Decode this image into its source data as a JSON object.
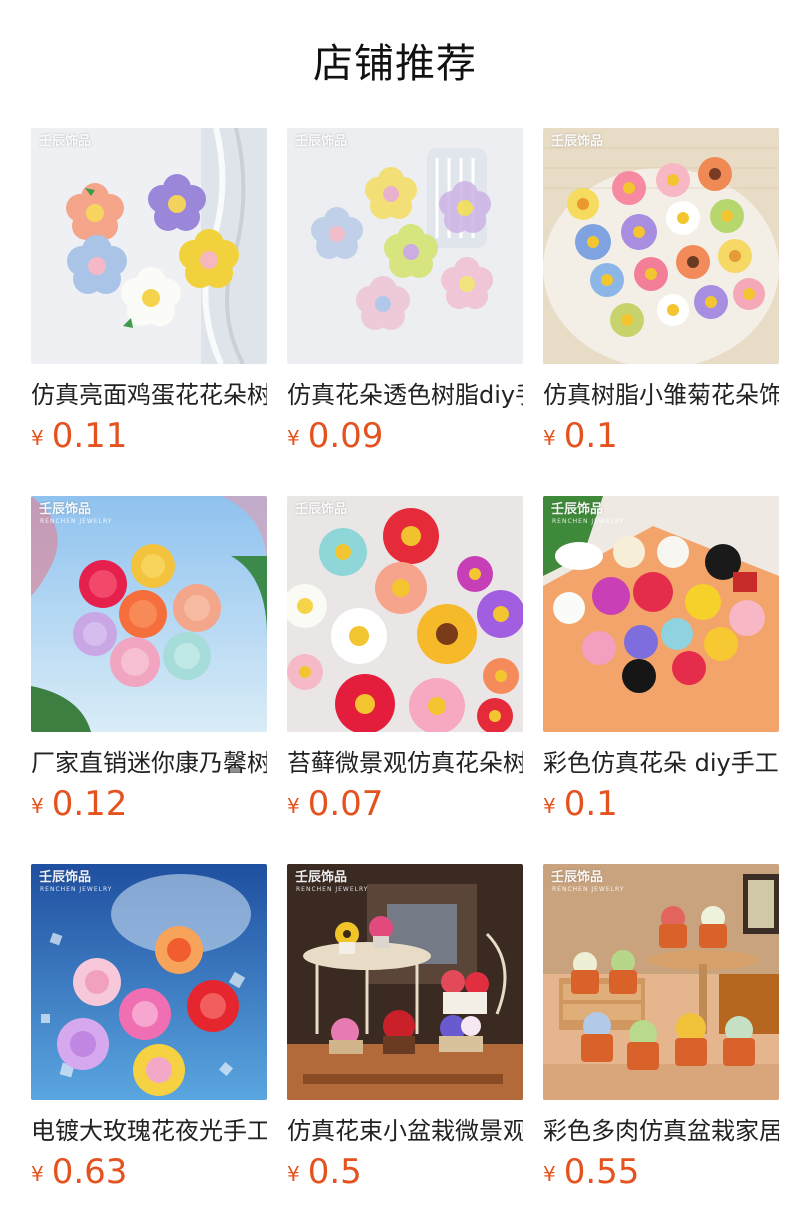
{
  "page_title": "店铺推荐",
  "accent_price_color": "#e4531f",
  "products": [
    {
      "name": "仿真亮面鸡蛋花花朵树脂diy",
      "currency": "¥",
      "price": "0.11",
      "brand": "壬辰饰品",
      "brand_sub": "",
      "scene": "pastel-flowers"
    },
    {
      "name": "仿真花朵透色树脂diy手工饰品",
      "currency": "¥",
      "price": "0.09",
      "brand": "壬辰饰品",
      "brand_sub": "",
      "scene": "translucent-flowers"
    },
    {
      "name": "仿真树脂小雏菊花朵饰品配件",
      "currency": "¥",
      "price": "0.1",
      "brand": "壬辰饰品",
      "brand_sub": "",
      "scene": "daisies"
    },
    {
      "name": "厂家直销迷你康乃馨树脂花朵",
      "currency": "¥",
      "price": "0.12",
      "brand": "壬辰饰品",
      "brand_sub": "RENCHEN JEWELRY",
      "scene": "carnations"
    },
    {
      "name": "苔藓微景观仿真花朵树脂配件",
      "currency": "¥",
      "price": "0.07",
      "brand": "壬辰饰品",
      "brand_sub": "",
      "scene": "colorful-daisies"
    },
    {
      "name": "彩色仿真花朵 diy手工饰品配件",
      "currency": "¥",
      "price": "0.1",
      "brand": "壬辰饰品",
      "brand_sub": "RENCHEN JEWELRY",
      "scene": "roses"
    },
    {
      "name": "电镀大玫瑰花夜光手工饰品",
      "currency": "¥",
      "price": "0.63",
      "brand": "壬辰饰品",
      "brand_sub": "RENCHEN JEWELRY",
      "scene": "glow-roses"
    },
    {
      "name": "仿真花束小盆栽微景观摆件",
      "currency": "¥",
      "price": "0.5",
      "brand": "壬辰饰品",
      "brand_sub": "RENCHEN JEWELRY",
      "scene": "bouquets"
    },
    {
      "name": "彩色多肉仿真盆栽家居摆件",
      "currency": "¥",
      "price": "0.55",
      "brand": "壬辰饰品",
      "brand_sub": "RENCHEN JEWELRY",
      "scene": "succulents"
    }
  ]
}
